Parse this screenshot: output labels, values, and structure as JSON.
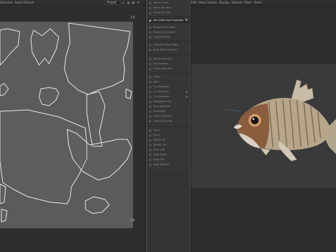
{
  "uv_editor": {
    "menu": [
      "Selection",
      "Select",
      "Texture"
    ],
    "projection_value": "Project",
    "coord_top": "1.0",
    "coord_bottom": "1.0"
  },
  "command_panel": {
    "items": [
      "Select Faces",
      "Select By Face",
      "Select All UVs",
      "Set UVW From Projection",
      "Project From View",
      "Project Cylindrical",
      "Project Planar",
      "Unwrap Along Edges",
      "Auto Seam Unwrap",
      "Relax Selected",
      "Pin Selected",
      "Unpin Selected",
      "Stitch",
      "Weld",
      "Cut Selected",
      "Cut Selected",
      "Cut Selected",
      "Straighten UVs",
      "Pack Selected",
      "Normalize",
      "Scale Selected",
      "Orient Selected",
      "Flip U",
      "Flip V",
      "Rotate 90",
      "Rotate -90",
      "Align Left",
      "Align Right",
      "Align Top",
      "Align Bottom"
    ],
    "active_item_index": 3
  },
  "viewport_3d": {
    "menu": [
      "Edit",
      "View",
      "Camera",
      "Display",
      "Options",
      "Filter",
      "Panel"
    ]
  },
  "colors": {
    "uv_sheet": "#5b5b5b",
    "uv_outline": "#e8e8e8",
    "panel_highlight": "#2a2a2a",
    "fish_body": "#b7a68b",
    "fish_head": "#8a5d3e"
  },
  "icons": [
    "lock-icon",
    "grid-icon",
    "gear-icon",
    "layout-icon"
  ]
}
